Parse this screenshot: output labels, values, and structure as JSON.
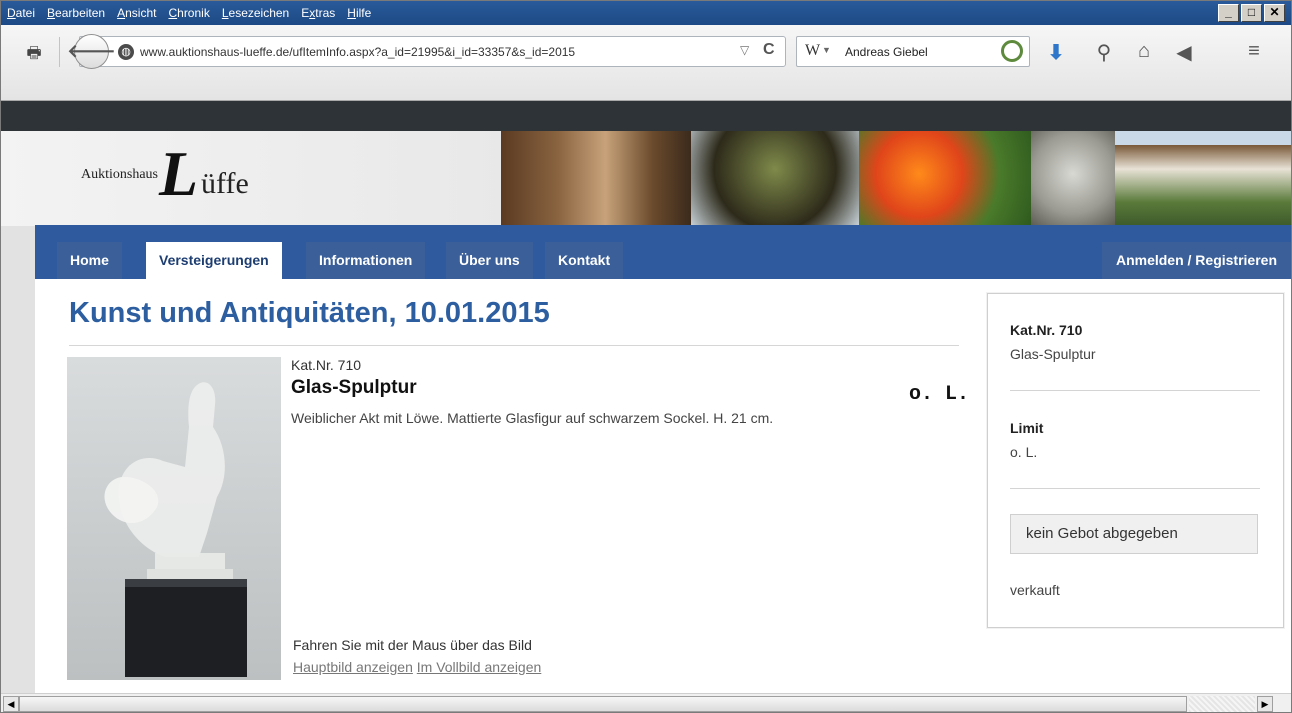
{
  "menu": {
    "items": [
      "Datei",
      "Bearbeiten",
      "Ansicht",
      "Chronik",
      "Lesezeichen",
      "Extras",
      "Hilfe"
    ],
    "accesskeys": [
      "D",
      "B",
      "A",
      "C",
      "L",
      "x",
      "H"
    ]
  },
  "window_buttons": [
    "_",
    "□",
    "✕"
  ],
  "toolbar": {
    "url": "www.auktionshaus-lueffe.de/ufItemInfo.aspx?a_id=21995&i_id=33357&s_id=2015",
    "search_engine": "W",
    "search_value": "Andreas Giebel"
  },
  "site": {
    "logo_small": "Auktionshaus",
    "logo_big": "L",
    "logo_rest": "üffe",
    "nav": [
      "Home",
      "Versteigerungen",
      "Informationen",
      "Über uns",
      "Kontakt"
    ],
    "active_nav": "Versteigerungen",
    "login": "Anmelden / Registrieren"
  },
  "auction": {
    "title": "Kunst und Antiquitäten, 10.01.2015"
  },
  "item": {
    "katnr": "Kat.Nr. 710",
    "title": "Glas-Spulptur",
    "limit": "o. L.",
    "description": "Weiblicher Akt mit Löwe. Mattierte Glasfigur auf schwarzem Sockel. H. 21 cm.",
    "hover_hint": "Fahren Sie mit der Maus über das Bild",
    "link_main": "Hauptbild anzeigen",
    "link_full": "Im Vollbild anzeigen"
  },
  "sidebox": {
    "katnr_label": "Kat.Nr. 710",
    "katnr_value": "Glas-Spulptur",
    "limit_label": "Limit",
    "limit_value": "o. L.",
    "bid_status": "kein Gebot abgegeben",
    "sold_status": "verkauft"
  },
  "colors": {
    "menubar": "#1d4a86",
    "site_nav": "#2f5a9e",
    "title": "#2c5ea0"
  }
}
